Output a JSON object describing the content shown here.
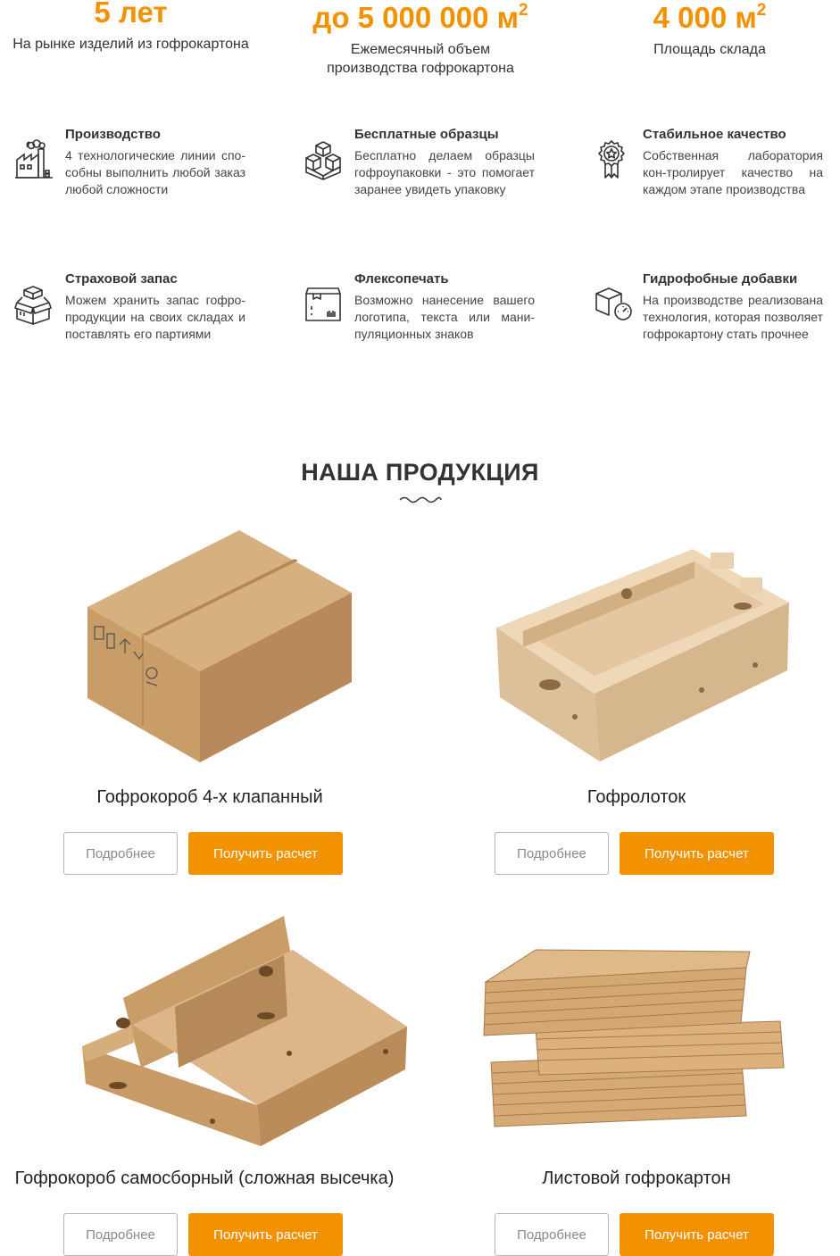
{
  "stats": [
    {
      "value": "5 лет",
      "sup": "",
      "label": "На рынке изделий из гофрокартона"
    },
    {
      "value": "до 5 000 000 м",
      "sup": "2",
      "label": "Ежемесячный объем производства гофрокартона"
    },
    {
      "value": "4 000 м",
      "sup": "2",
      "label": "Площадь склада"
    }
  ],
  "features": [
    {
      "icon": "factory-icon",
      "title": "Производство",
      "text": "4 технологические линии спо-собны выполнить любой заказ любой сложности"
    },
    {
      "icon": "boxes-stack-icon",
      "title": "Бесплатные образцы",
      "text": "Бесплатно делаем образцы гофроупаковки - это помогает заранее увидеть упаковку"
    },
    {
      "icon": "quality-badge-icon",
      "title": "Стабильное качество",
      "text": "Собственная лаборатория кон-тролирует качество на каждом этапе производства"
    },
    {
      "icon": "open-box-icon",
      "title": "Страховой запас",
      "text": "Можем хранить запас гофро-продукции на своих складах и поставлять его партиями"
    },
    {
      "icon": "printed-box-icon",
      "title": "Флексопечать",
      "text": "Возможно нанесение вашего логотипа, текста или мани-пуляционных знаков"
    },
    {
      "icon": "box-gauge-icon",
      "title": "Гидрофобные добавки",
      "text": "На производстве реализована технология, которая позволяет гофрокартону стать прочнее"
    }
  ],
  "products_section": {
    "title": "НАША ПРОДУКЦИЯ",
    "items": [
      {
        "image": "closed-box-image",
        "title": "Гофрокороб 4-х клапанный",
        "more_label": "Подробнее",
        "calc_label": "Получить расчет"
      },
      {
        "image": "tray-image",
        "title": "Гофролоток",
        "more_label": "Подробнее",
        "calc_label": "Получить расчет"
      },
      {
        "image": "self-assembly-box-image",
        "title": "Гофрокороб самосборный (сложная высечка)",
        "more_label": "Подробнее",
        "calc_label": "Получить расчет"
      },
      {
        "image": "sheets-stack-image",
        "title": "Листовой гофрокартон",
        "more_label": "Подробнее",
        "calc_label": "Получить расчет"
      }
    ]
  },
  "colors": {
    "accent": "#f39200",
    "text": "#333333",
    "cardboard": "#c9a06e"
  }
}
